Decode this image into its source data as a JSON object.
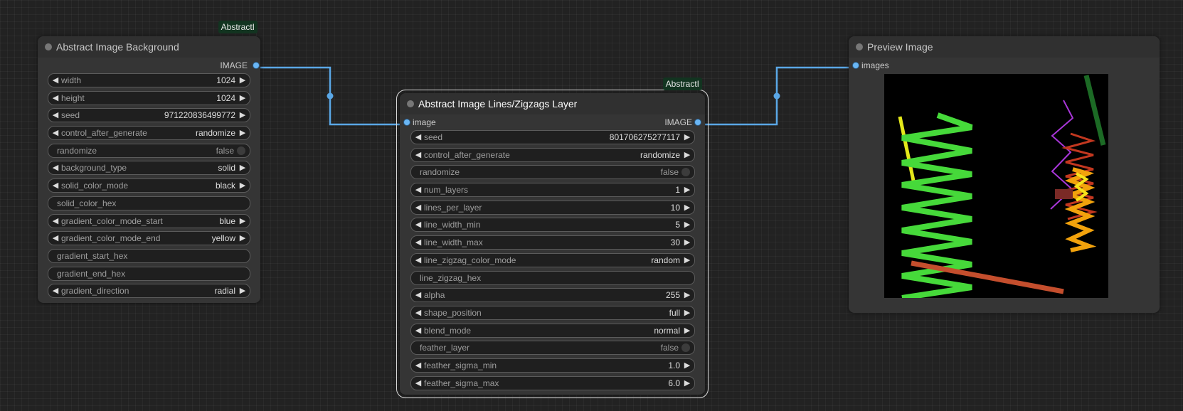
{
  "colors": {
    "link": "#5aa7e6",
    "canvas_bg": "#222222",
    "node_bg": "#353535",
    "badge_bg": "#123420"
  },
  "nodes": {
    "background": {
      "title": "Abstract Image Background",
      "badge": "AbstractI",
      "output_label": "IMAGE",
      "widgets": [
        {
          "type": "combo",
          "name": "width",
          "value": "1024"
        },
        {
          "type": "combo",
          "name": "height",
          "value": "1024"
        },
        {
          "type": "combo",
          "name": "seed",
          "value": "971220836499772"
        },
        {
          "type": "combo",
          "name": "control_after_generate",
          "value": "randomize"
        },
        {
          "type": "toggle",
          "name": "randomize",
          "value": "false"
        },
        {
          "type": "combo",
          "name": "background_type",
          "value": "solid"
        },
        {
          "type": "combo",
          "name": "solid_color_mode",
          "value": "black"
        },
        {
          "type": "text",
          "name": "solid_color_hex",
          "value": ""
        },
        {
          "type": "combo",
          "name": "gradient_color_mode_start",
          "value": "blue"
        },
        {
          "type": "combo",
          "name": "gradient_color_mode_end",
          "value": "yellow"
        },
        {
          "type": "text",
          "name": "gradient_start_hex",
          "value": ""
        },
        {
          "type": "text",
          "name": "gradient_end_hex",
          "value": ""
        },
        {
          "type": "combo",
          "name": "gradient_direction",
          "value": "radial"
        }
      ]
    },
    "lines": {
      "title": "Abstract Image Lines/Zigzags Layer",
      "badge": "AbstractI",
      "input_label": "image",
      "output_label": "IMAGE",
      "widgets": [
        {
          "type": "combo",
          "name": "seed",
          "value": "801706275277117"
        },
        {
          "type": "combo",
          "name": "control_after_generate",
          "value": "randomize"
        },
        {
          "type": "toggle",
          "name": "randomize",
          "value": "false"
        },
        {
          "type": "combo",
          "name": "num_layers",
          "value": "1"
        },
        {
          "type": "combo",
          "name": "lines_per_layer",
          "value": "10"
        },
        {
          "type": "combo",
          "name": "line_width_min",
          "value": "5"
        },
        {
          "type": "combo",
          "name": "line_width_max",
          "value": "30"
        },
        {
          "type": "combo",
          "name": "line_zigzag_color_mode",
          "value": "random"
        },
        {
          "type": "text",
          "name": "line_zigzag_hex",
          "value": ""
        },
        {
          "type": "combo",
          "name": "alpha",
          "value": "255"
        },
        {
          "type": "combo",
          "name": "shape_position",
          "value": "full"
        },
        {
          "type": "combo",
          "name": "blend_mode",
          "value": "normal"
        },
        {
          "type": "toggle",
          "name": "feather_layer",
          "value": "false"
        },
        {
          "type": "combo",
          "name": "feather_sigma_min",
          "value": "1.0"
        },
        {
          "type": "combo",
          "name": "feather_sigma_max",
          "value": "6.0"
        }
      ]
    },
    "preview": {
      "title": "Preview Image",
      "input_label": "images"
    }
  }
}
